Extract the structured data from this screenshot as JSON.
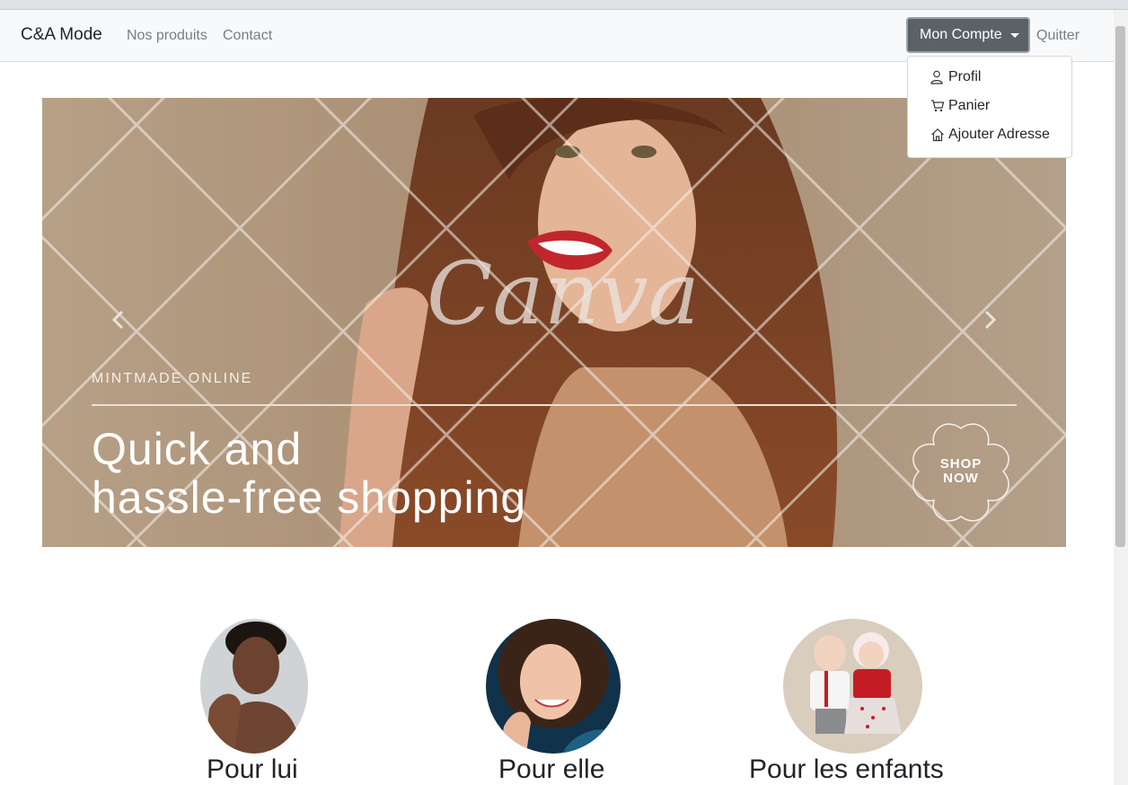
{
  "navbar": {
    "brand": "C&A Mode",
    "links": [
      "Nos produits",
      "Contact"
    ],
    "account_button": "Mon Compte",
    "quit": "Quitter"
  },
  "dropdown": {
    "items": [
      {
        "label": "Profil",
        "icon": "user-icon"
      },
      {
        "label": "Panier",
        "icon": "cart-icon"
      },
      {
        "label": "Ajouter Adresse",
        "icon": "home-icon"
      }
    ]
  },
  "carousel": {
    "subtitle": "MINTMADE ONLINE",
    "headline_line1": "Quick and",
    "headline_line2": "hassle-free shopping",
    "watermark": "Canva",
    "shop_line1": "SHOP",
    "shop_line2": "NOW",
    "background_color": "#b29c84"
  },
  "categories": [
    {
      "label": "Pour lui"
    },
    {
      "label": "Pour elle"
    },
    {
      "label": "Pour les enfants"
    }
  ]
}
